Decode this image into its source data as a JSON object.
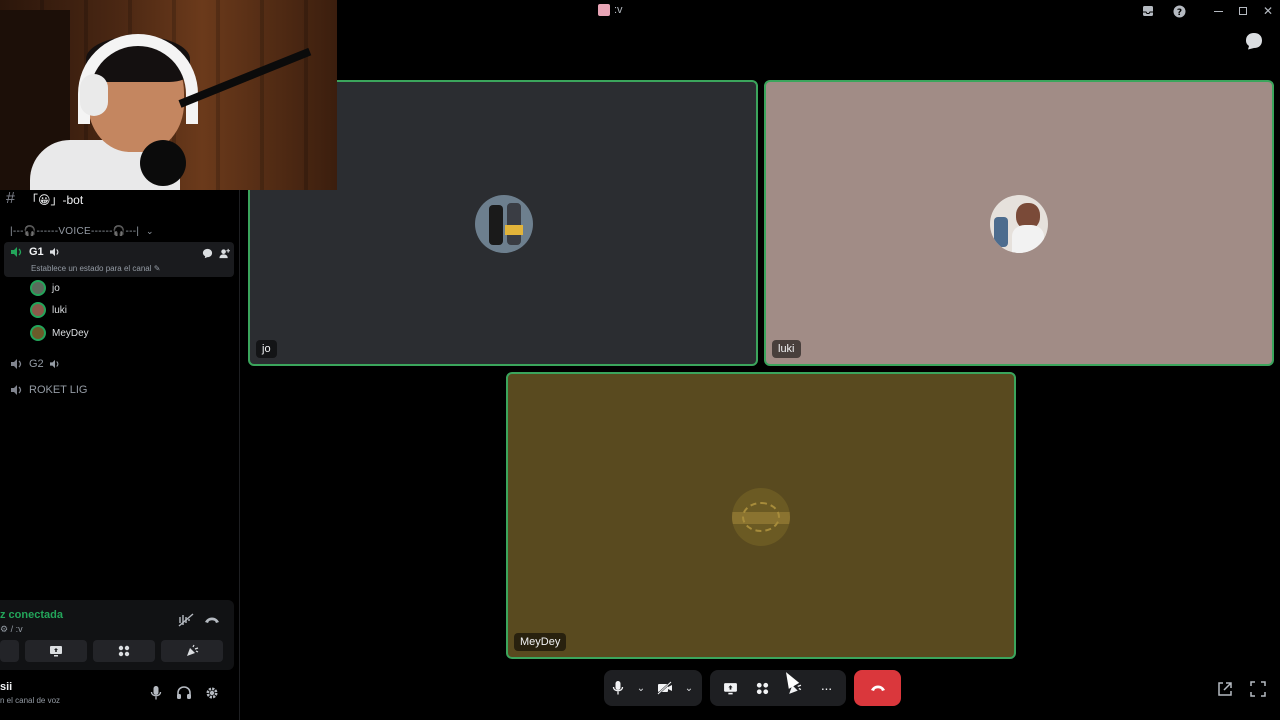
{
  "window": {
    "title": ":v",
    "controls": [
      "inbox-icon",
      "help-icon",
      "minimize-icon",
      "maximize-icon",
      "close-icon"
    ]
  },
  "sidebar": {
    "text_channel": "「😀」-bot",
    "category": "|---🎧------VOICE------🎧---|",
    "voice_channels": [
      {
        "name": "G1",
        "active": true,
        "status_placeholder": "Establece un estado para el canal"
      },
      {
        "name": "G2",
        "active": false
      },
      {
        "name": "ROKET LIG",
        "active": false
      }
    ],
    "connected_users": [
      "jo",
      "luki",
      "MeyDey"
    ]
  },
  "voice_panel": {
    "status": "z conectada",
    "channel": "⚙ / :v"
  },
  "user_panel": {
    "name": "sii",
    "subtext": "n el canal de voz"
  },
  "tiles": [
    {
      "label": "jo",
      "bg": "#2b2d31"
    },
    {
      "label": "luki",
      "bg": "#a18c86"
    },
    {
      "label": "MeyDey",
      "bg": "#594a1f"
    }
  ],
  "colors": {
    "speaking_border": "#3ba55c",
    "hangup": "#da373c",
    "connected": "#23a55a"
  }
}
